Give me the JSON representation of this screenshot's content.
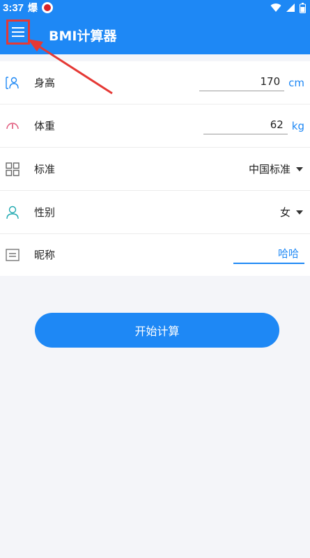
{
  "statusbar": {
    "time": "3:37",
    "notification_text": "爆"
  },
  "appbar": {
    "title": "BMI计算器"
  },
  "form": {
    "height": {
      "label": "身高",
      "value": "170",
      "unit": "cm"
    },
    "weight": {
      "label": "体重",
      "value": "62",
      "unit": "kg"
    },
    "standard": {
      "label": "标准",
      "value": "中国标准"
    },
    "gender": {
      "label": "性别",
      "value": "女"
    },
    "nickname": {
      "label": "昵称",
      "value": "哈哈"
    }
  },
  "actions": {
    "start_label": "开始计算"
  },
  "colors": {
    "primary": "#1e88f5",
    "background": "#f4f5f9",
    "highlight": "#e53935",
    "weight_icon": "#e0567a"
  }
}
